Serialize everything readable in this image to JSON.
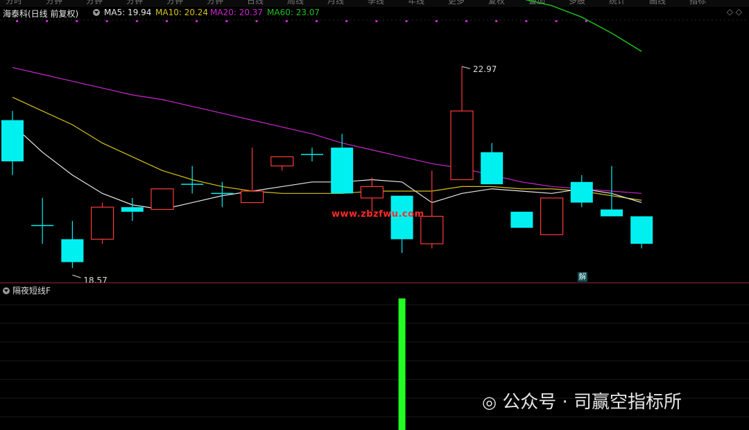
{
  "toolbar_tabs": [
    "分时",
    "分钟",
    "分钟",
    "分钟",
    "分钟",
    "分钟",
    "日线",
    "周线",
    "月线",
    "季线",
    "年线",
    "更多",
    "复权",
    "叠加",
    "多股",
    "统计",
    "画线",
    "指标"
  ],
  "header": {
    "stock_title": "海泰科(日线 前复权)",
    "ma5_label": "MA5: 19.94",
    "ma10_label": "MA10: 20.24",
    "ma20_label": "MA20: 20.37",
    "ma60_label": "MA60: 23.07",
    "right_icons": "◇  ◇"
  },
  "colors": {
    "ma5": "#e8e8e8",
    "ma10": "#d8c418",
    "ma20": "#cc28cc",
    "ma60": "#1fbf1f",
    "up": "#ff3a3a",
    "down": "#00f0f0",
    "indicator_bar": "#22ff22"
  },
  "annotations": {
    "high_label": "22.97",
    "low_label": "18.57",
    "jie_badge": "解",
    "watermark": "www.zbzfwu.com"
  },
  "lower_panel": {
    "title": "隔夜短线F",
    "signal_index": 13
  },
  "footer": {
    "wechat_text": "公众号 · 司赢空指标所"
  },
  "chart_data": {
    "type": "candlestick",
    "price_range": [
      18.3,
      24.0
    ],
    "candles": [
      {
        "o": 21.8,
        "h": 22.0,
        "l": 20.6,
        "c": 20.9,
        "dir": "down"
      },
      {
        "o": 19.5,
        "h": 20.1,
        "l": 19.1,
        "c": 19.5,
        "dir": "down"
      },
      {
        "o": 19.2,
        "h": 19.6,
        "l": 18.57,
        "c": 18.7,
        "dir": "down"
      },
      {
        "o": 19.2,
        "h": 20.0,
        "l": 19.1,
        "c": 19.9,
        "dir": "up"
      },
      {
        "o": 19.9,
        "h": 20.1,
        "l": 19.6,
        "c": 19.8,
        "dir": "down"
      },
      {
        "o": 19.85,
        "h": 20.3,
        "l": 19.85,
        "c": 20.3,
        "dir": "up"
      },
      {
        "o": 20.4,
        "h": 20.8,
        "l": 20.2,
        "c": 20.4,
        "dir": "down"
      },
      {
        "o": 20.2,
        "h": 20.45,
        "l": 19.9,
        "c": 20.2,
        "dir": "down"
      },
      {
        "o": 20.0,
        "h": 21.2,
        "l": 20.0,
        "c": 20.25,
        "dir": "up"
      },
      {
        "o": 20.8,
        "h": 21.0,
        "l": 20.7,
        "c": 21.0,
        "dir": "up"
      },
      {
        "o": 21.05,
        "h": 21.2,
        "l": 20.9,
        "c": 21.05,
        "dir": "down"
      },
      {
        "o": 21.2,
        "h": 21.5,
        "l": 20.2,
        "c": 20.2,
        "dir": "down"
      },
      {
        "o": 20.1,
        "h": 20.55,
        "l": 19.8,
        "c": 20.35,
        "dir": "up"
      },
      {
        "o": 20.15,
        "h": 20.15,
        "l": 18.9,
        "c": 19.2,
        "dir": "down"
      },
      {
        "o": 19.1,
        "h": 20.7,
        "l": 19.0,
        "c": 19.7,
        "dir": "up"
      },
      {
        "o": 20.5,
        "h": 22.97,
        "l": 20.5,
        "c": 22.0,
        "dir": "up"
      },
      {
        "o": 21.1,
        "h": 21.3,
        "l": 20.4,
        "c": 20.4,
        "dir": "down"
      },
      {
        "o": 19.8,
        "h": 19.8,
        "l": 19.45,
        "c": 19.45,
        "dir": "down"
      },
      {
        "o": 19.3,
        "h": 20.1,
        "l": 19.3,
        "c": 20.1,
        "dir": "up"
      },
      {
        "o": 20.45,
        "h": 20.6,
        "l": 19.9,
        "c": 20.0,
        "dir": "down"
      },
      {
        "o": 19.85,
        "h": 20.8,
        "l": 19.7,
        "c": 19.7,
        "dir": "down"
      },
      {
        "o": 19.7,
        "h": 19.7,
        "l": 19.0,
        "c": 19.1,
        "dir": "down"
      }
    ],
    "ma5": [
      21.7,
      21.1,
      20.6,
      20.2,
      19.95,
      19.85,
      20.0,
      20.15,
      20.25,
      20.35,
      20.45,
      20.45,
      20.5,
      20.45,
      20.0,
      20.2,
      20.3,
      20.25,
      20.2,
      20.3,
      20.2,
      20.0
    ],
    "ma10": [
      22.3,
      22.0,
      21.7,
      21.3,
      21.0,
      20.7,
      20.5,
      20.35,
      20.25,
      20.2,
      20.2,
      20.2,
      20.25,
      20.25,
      20.25,
      20.35,
      20.35,
      20.3,
      20.3,
      20.25,
      20.15,
      20.05
    ],
    "ma20": [
      22.95,
      22.8,
      22.65,
      22.5,
      22.35,
      22.25,
      22.1,
      21.95,
      21.8,
      21.65,
      21.5,
      21.3,
      21.15,
      21.0,
      20.85,
      20.75,
      20.6,
      20.45,
      20.35,
      20.3,
      20.25,
      20.2
    ],
    "ma60": [
      25.3,
      25.28,
      25.26,
      25.24,
      25.22,
      25.2,
      25.17,
      25.14,
      25.1,
      25.06,
      25.02,
      24.97,
      24.92,
      24.85,
      24.77,
      24.68,
      24.58,
      24.45,
      24.3,
      24.05,
      23.7,
      23.3
    ]
  }
}
